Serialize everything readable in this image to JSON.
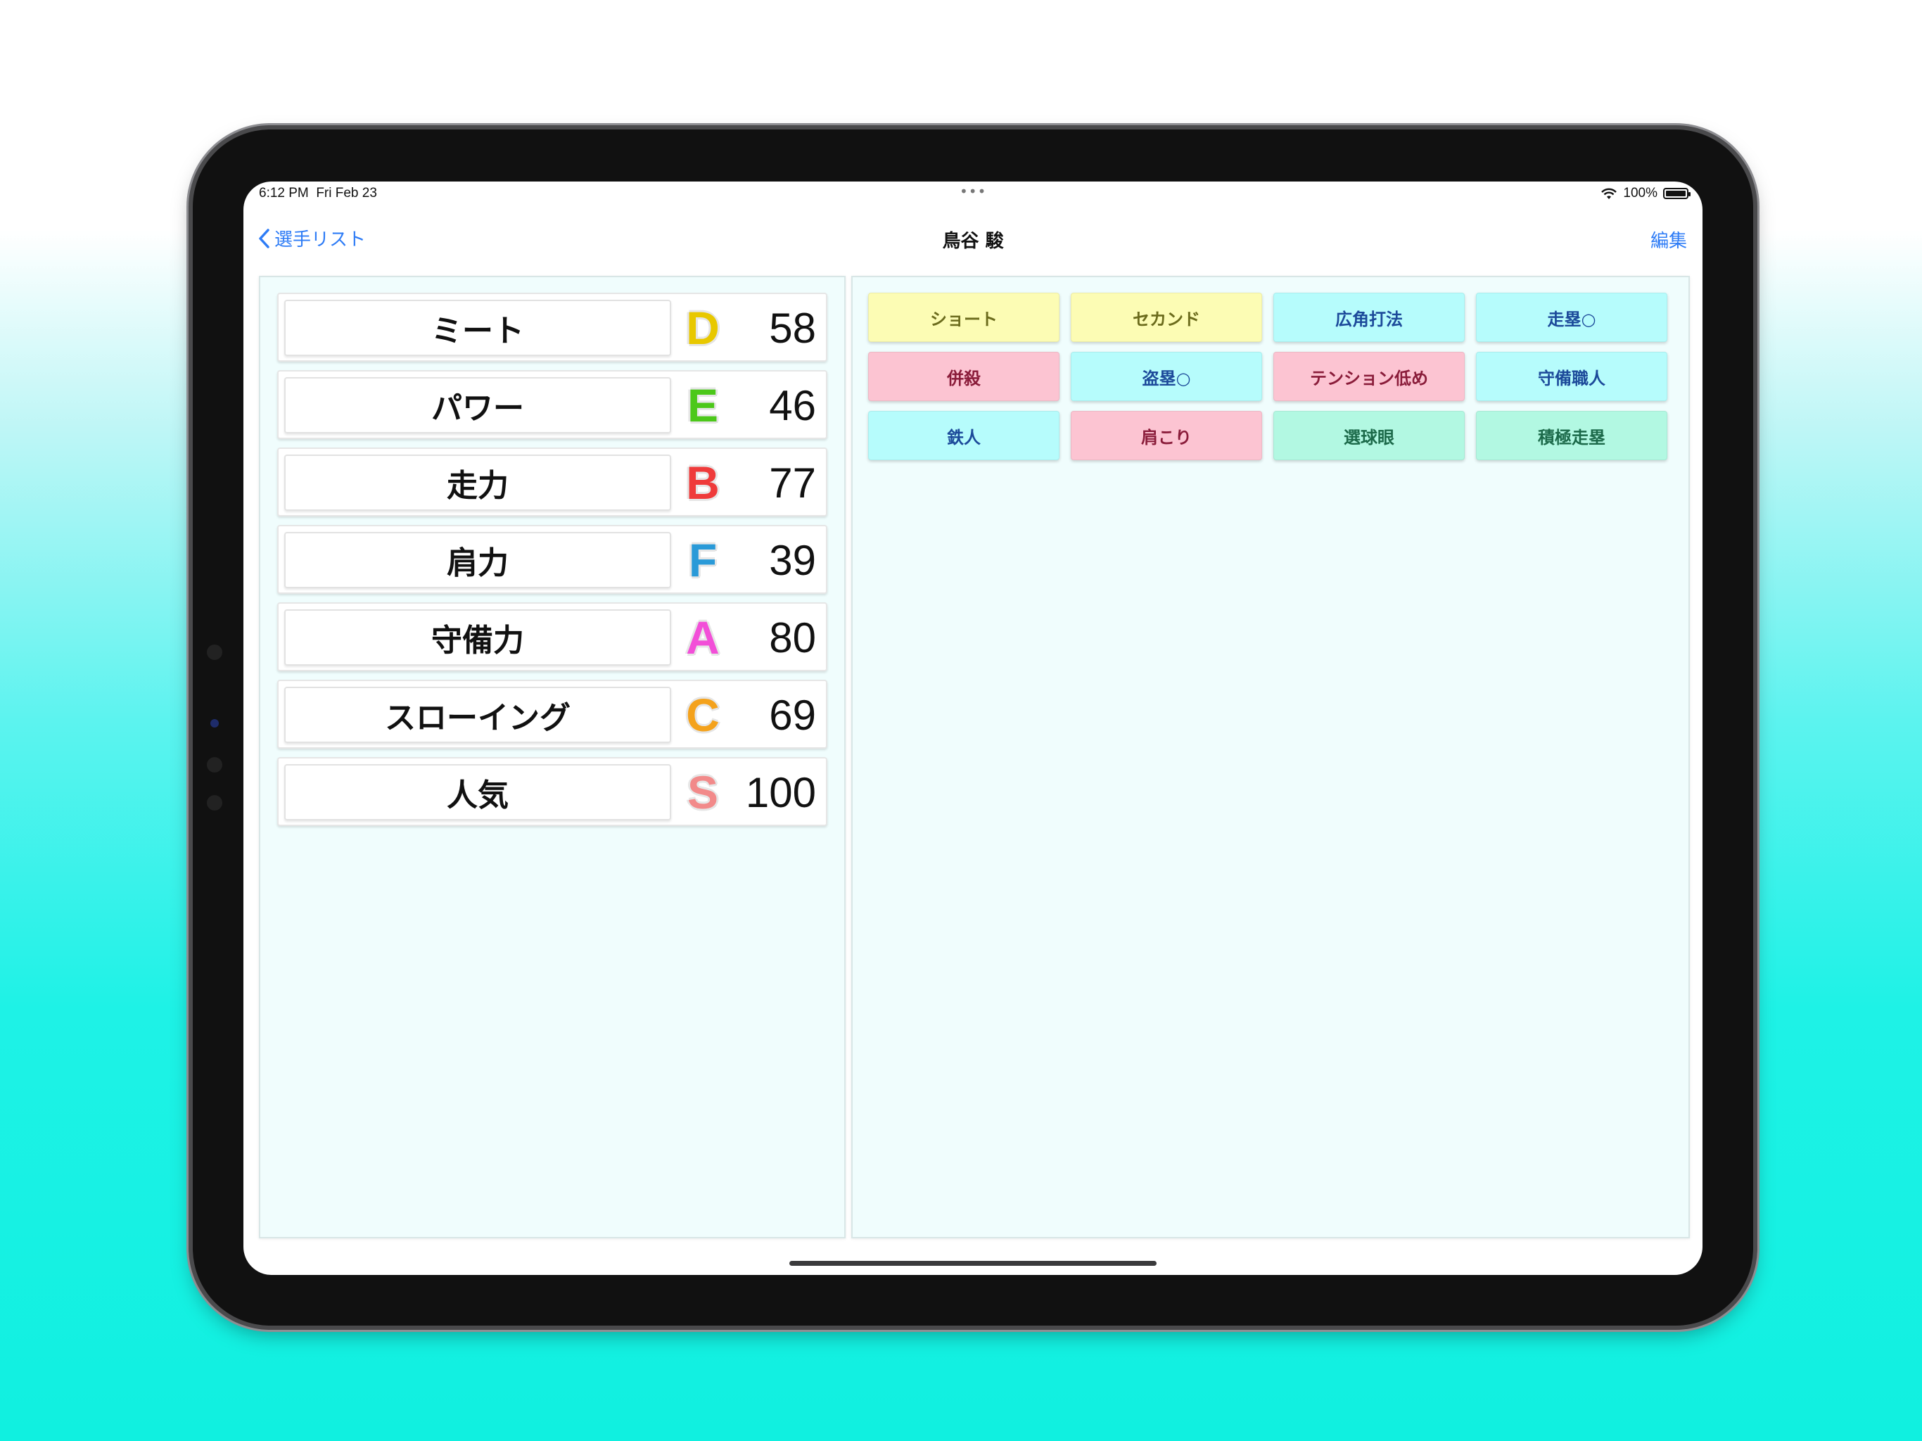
{
  "status_bar": {
    "time": "6:12 PM",
    "date": "Fri Feb 23",
    "multitask": "•••",
    "battery": "100%"
  },
  "nav": {
    "back_label": "選手リスト",
    "title": "鳥谷 駿",
    "edit_label": "編集"
  },
  "stats": [
    {
      "label": "ミート",
      "grade": "D",
      "grade_color": "#e8c800",
      "value": "58"
    },
    {
      "label": "パワー",
      "grade": "E",
      "grade_color": "#4cc81a",
      "value": "46"
    },
    {
      "label": "走力",
      "grade": "B",
      "grade_color": "#ef3b3b",
      "value": "77"
    },
    {
      "label": "肩力",
      "grade": "F",
      "grade_color": "#2a9ad8",
      "value": "39"
    },
    {
      "label": "守備力",
      "grade": "A",
      "grade_color": "#f24fd8",
      "value": "80"
    },
    {
      "label": "スローイング",
      "grade": "C",
      "grade_color": "#f4a21c",
      "value": "69"
    },
    {
      "label": "人気",
      "grade": "S",
      "grade_color": "#f28a8a",
      "value": "100"
    }
  ],
  "tags": [
    {
      "label": "ショート",
      "bg": "#fcfcb4",
      "fg": "#6b6b1c"
    },
    {
      "label": "セカンド",
      "bg": "#fcfcb4",
      "fg": "#6b6b1c"
    },
    {
      "label": "広角打法",
      "bg": "#b6fcfc",
      "fg": "#1c4a9a"
    },
    {
      "label": "走塁○",
      "bg": "#b6fcfc",
      "fg": "#1c4a9a"
    },
    {
      "label": "併殺",
      "bg": "#fcc4d2",
      "fg": "#8a1c3a"
    },
    {
      "label": "盗塁○",
      "bg": "#b6fcfc",
      "fg": "#1c4a9a"
    },
    {
      "label": "テンション低め",
      "bg": "#fcc4d2",
      "fg": "#8a1c3a"
    },
    {
      "label": "守備職人",
      "bg": "#b6fcfc",
      "fg": "#1c4a9a"
    },
    {
      "label": "鉄人",
      "bg": "#b6fcfc",
      "fg": "#1c4a9a"
    },
    {
      "label": "肩こり",
      "bg": "#fcc4d2",
      "fg": "#8a1c3a"
    },
    {
      "label": "選球眼",
      "bg": "#b2f8e2",
      "fg": "#1c6a4a"
    },
    {
      "label": "積極走塁",
      "bg": "#b2f8e2",
      "fg": "#1c6a4a"
    }
  ]
}
